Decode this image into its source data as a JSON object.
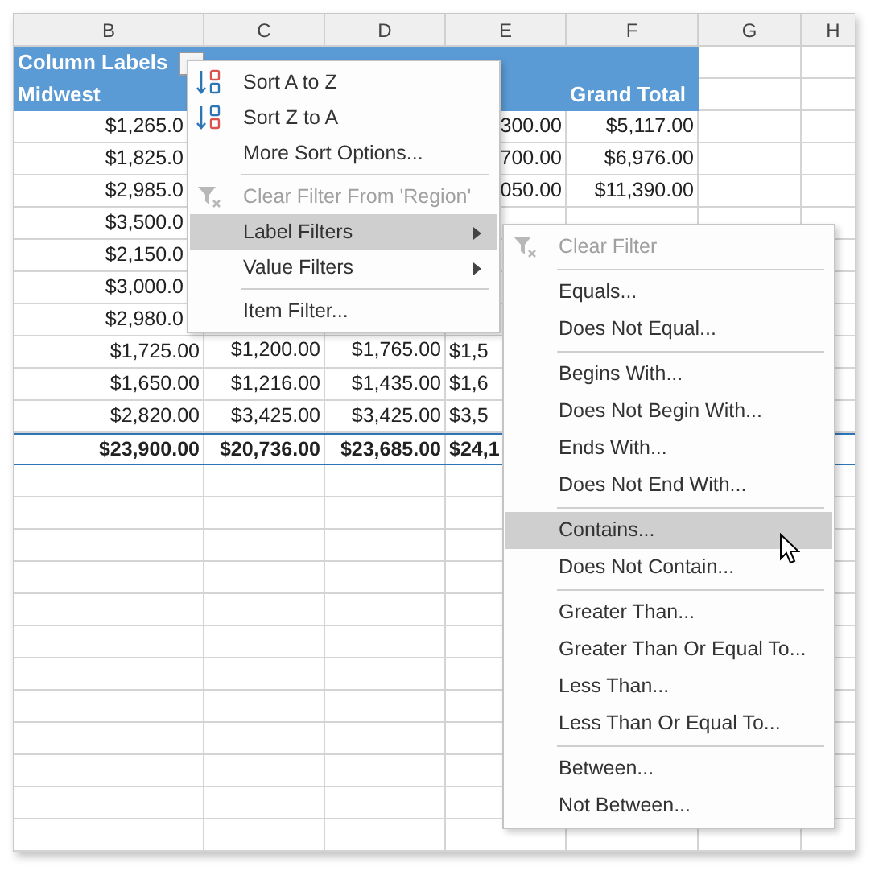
{
  "sheet": {
    "columns": [
      "B",
      "C",
      "D",
      "E",
      "F",
      "G",
      "H"
    ],
    "header": {
      "column_labels": "Column Labels",
      "row_label": "Midwest",
      "grand_total": "Grand Total"
    },
    "rows": [
      {
        "B": "$1,265.0",
        "E": "300.00",
        "F": "$5,117.00"
      },
      {
        "B": "$1,825.0",
        "E": "700.00",
        "F": "$6,976.00"
      },
      {
        "B": "$2,985.0",
        "E": "050.00",
        "F": "$11,390.00"
      },
      {
        "B": "$3,500.0"
      },
      {
        "B": "$2,150.0"
      },
      {
        "B": "$3,000.0"
      },
      {
        "B": "$2,980.0"
      },
      {
        "B": "$1,725.00",
        "C": "$1,200.00",
        "D": "$1,765.00",
        "E": "$1,5"
      },
      {
        "B": "$1,650.00",
        "C": "$1,216.00",
        "D": "$1,435.00",
        "E": "$1,6"
      },
      {
        "B": "$2,820.00",
        "C": "$3,425.00",
        "D": "$3,425.00",
        "E": "$3,5"
      }
    ],
    "total_row": {
      "B": "$23,900.00",
      "C": "$20,736.00",
      "D": "$23,685.00",
      "E": "$24,1"
    }
  },
  "context_menu": {
    "items": [
      {
        "kind": "sort_asc",
        "label": "Sort A to Z",
        "disabled": false,
        "highlighted": false
      },
      {
        "kind": "sort_desc",
        "label": "Sort Z to A",
        "disabled": false,
        "highlighted": false
      },
      {
        "kind": "item",
        "label": "More Sort Options...",
        "disabled": false,
        "highlighted": false
      },
      {
        "kind": "separator"
      },
      {
        "kind": "clear_filter",
        "label": "Clear Filter From 'Region'",
        "disabled": true,
        "highlighted": false
      },
      {
        "kind": "submenu",
        "label": "Label Filters",
        "disabled": false,
        "highlighted": true
      },
      {
        "kind": "submenu",
        "label": "Value Filters",
        "disabled": false,
        "highlighted": false
      },
      {
        "kind": "separator"
      },
      {
        "kind": "item",
        "label": "Item Filter...",
        "disabled": false,
        "highlighted": false
      }
    ]
  },
  "submenu": {
    "items": [
      {
        "kind": "clear_filter",
        "label": "Clear Filter",
        "disabled": true,
        "highlighted": false
      },
      {
        "kind": "separator"
      },
      {
        "kind": "item",
        "label": "Equals...",
        "disabled": false,
        "highlighted": false
      },
      {
        "kind": "item",
        "label": "Does Not Equal...",
        "disabled": false,
        "highlighted": false
      },
      {
        "kind": "separator"
      },
      {
        "kind": "item",
        "label": "Begins With...",
        "disabled": false,
        "highlighted": false
      },
      {
        "kind": "item",
        "label": "Does Not Begin With...",
        "disabled": false,
        "highlighted": false
      },
      {
        "kind": "item",
        "label": "Ends With...",
        "disabled": false,
        "highlighted": false
      },
      {
        "kind": "item",
        "label": "Does Not End With...",
        "disabled": false,
        "highlighted": false
      },
      {
        "kind": "separator"
      },
      {
        "kind": "item",
        "label": "Contains...",
        "disabled": false,
        "highlighted": true
      },
      {
        "kind": "item",
        "label": "Does Not Contain...",
        "disabled": false,
        "highlighted": false
      },
      {
        "kind": "separator"
      },
      {
        "kind": "item",
        "label": "Greater Than...",
        "disabled": false,
        "highlighted": false
      },
      {
        "kind": "item",
        "label": "Greater Than Or Equal To...",
        "disabled": false,
        "highlighted": false
      },
      {
        "kind": "item",
        "label": "Less Than...",
        "disabled": false,
        "highlighted": false
      },
      {
        "kind": "item",
        "label": "Less Than Or Equal To...",
        "disabled": false,
        "highlighted": false
      },
      {
        "kind": "separator"
      },
      {
        "kind": "item",
        "label": "Between...",
        "disabled": false,
        "highlighted": false
      },
      {
        "kind": "item",
        "label": "Not Between...",
        "disabled": false,
        "highlighted": false
      }
    ]
  }
}
